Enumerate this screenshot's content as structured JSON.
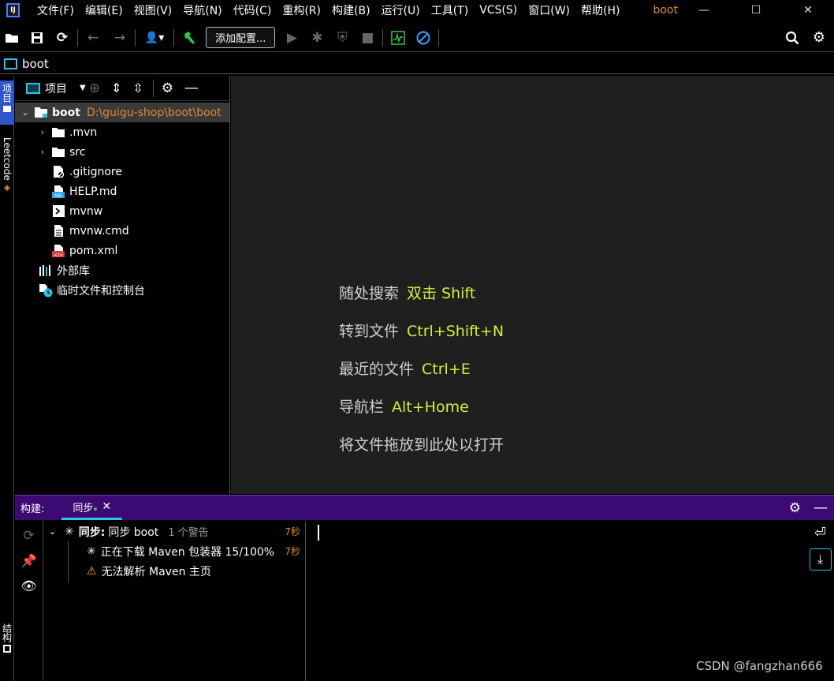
{
  "menu": {
    "items": [
      "文件(F)",
      "编辑(E)",
      "视图(V)",
      "导航(N)",
      "代码(C)",
      "重构(R)",
      "构建(B)",
      "运行(U)",
      "工具(T)",
      "VCS(S)",
      "窗口(W)",
      "帮助(H)"
    ],
    "project_title": "boot"
  },
  "toolbar": {
    "add_config_label": "添加配置..."
  },
  "navbar": {
    "crumb": "boot"
  },
  "left_strip": {
    "project_tab": "项目",
    "leetcode_tab": "Leetcode",
    "structure_tab": "结构"
  },
  "project": {
    "view_label": "项目",
    "root_name": "boot",
    "root_path": "D:\\guigu-shop\\boot\\boot",
    "children": [
      ".mvn",
      "src",
      ".gitignore",
      "HELP.md",
      "mvnw",
      "mvnw.cmd",
      "pom.xml"
    ],
    "external_libs": "外部库",
    "scratches": "临时文件和控制台"
  },
  "editor": {
    "hints": [
      {
        "text": "随处搜索",
        "key": "双击 Shift"
      },
      {
        "text": "转到文件",
        "key": "Ctrl+Shift+N"
      },
      {
        "text": "最近的文件",
        "key": "Ctrl+E"
      },
      {
        "text": "导航栏",
        "key": "Alt+Home"
      }
    ],
    "drop_hint": "将文件拖放到此处以打开"
  },
  "build": {
    "label": "构建:",
    "tab_label": "同步",
    "sync_bold": "同步:",
    "sync_text": "同步 boot",
    "warning_count": "1 个警告",
    "sync_time": "7秒",
    "download_text": "正在下载 Maven 包装器 15/100%",
    "download_time": "7秒",
    "warn_text": "无法解析 Maven 主页"
  },
  "watermark": "CSDN @fangzhan666",
  "colors": {
    "accent": "#d3ee3b",
    "path": "#e08a2e",
    "build_header": "#3b0a73",
    "editor_bg": "#1f1f1f"
  }
}
